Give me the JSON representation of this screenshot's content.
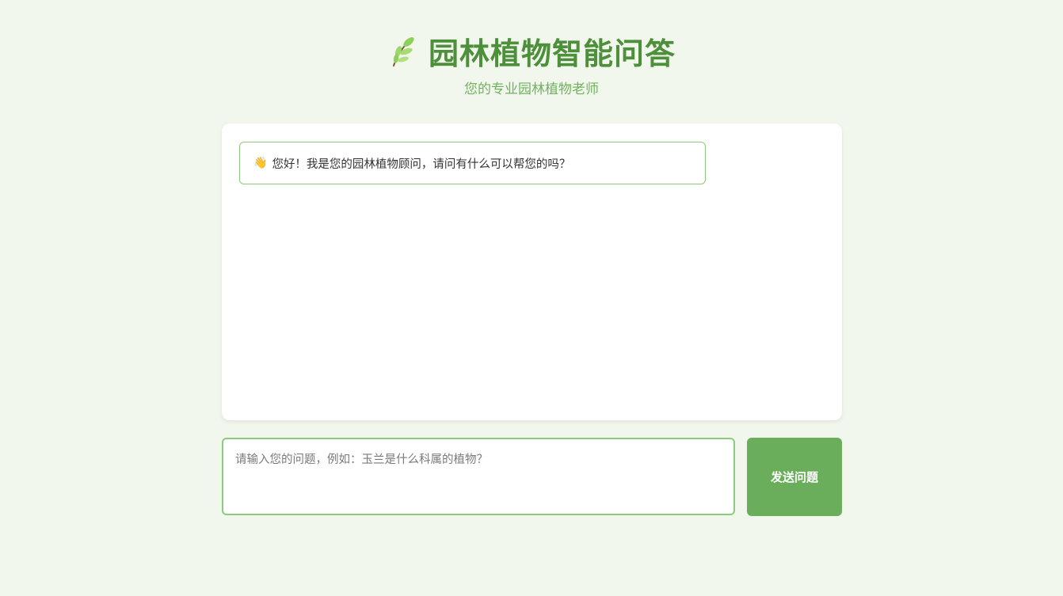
{
  "header": {
    "icon": "leaf-icon",
    "title": "园林植物智能问答",
    "subtitle": "您的专业园林植物老师"
  },
  "chat": {
    "messages": [
      {
        "role": "bot",
        "icon": "waving-hand-icon",
        "text": "您好！我是您的园林植物顾问，请问有什么可以帮您的吗？"
      }
    ]
  },
  "composer": {
    "placeholder": "请输入您的问题，例如：玉兰是什么科属的植物？",
    "value": "",
    "send_label": "发送问题"
  },
  "colors": {
    "background": "#f1f7ec",
    "title": "#4d8f3a",
    "subtitle": "#72b25f",
    "accent_border": "#8ccb7a",
    "button": "#6aae5c"
  }
}
